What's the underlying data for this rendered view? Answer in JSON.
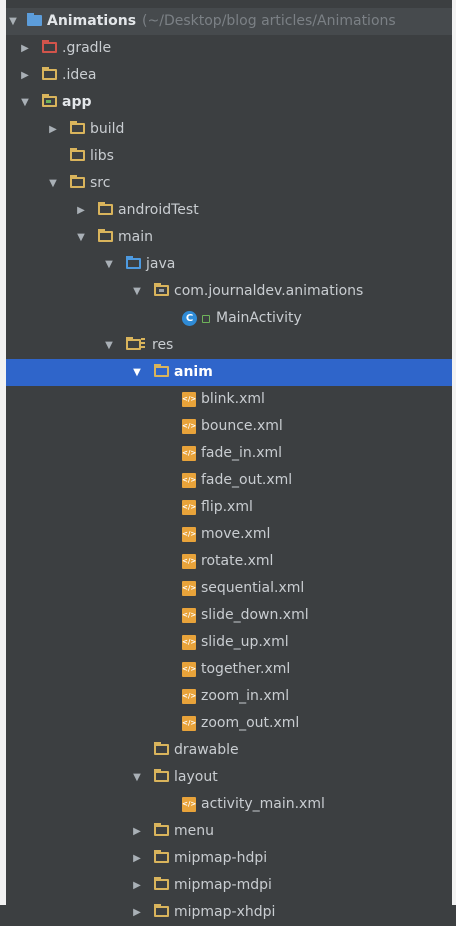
{
  "root": {
    "label": "Animations",
    "path": "(~/Desktop/blog articles/Animations"
  },
  "tree": [
    {
      "label": ".gradle",
      "depth": 1,
      "arrow": "right",
      "icon": "folder-red-icon",
      "kind": "folder red"
    },
    {
      "label": ".idea",
      "depth": 1,
      "arrow": "right",
      "icon": "folder-icon",
      "kind": "folder"
    },
    {
      "label": "app",
      "depth": 1,
      "arrow": "down",
      "icon": "app-module-folder-icon",
      "kind": "folder app",
      "bold": true
    },
    {
      "label": "build",
      "depth": 2,
      "arrow": "right",
      "icon": "folder-icon",
      "kind": "folder"
    },
    {
      "label": "libs",
      "depth": 2,
      "arrow": "",
      "icon": "folder-icon",
      "kind": "folder"
    },
    {
      "label": "src",
      "depth": 2,
      "arrow": "down",
      "icon": "folder-icon",
      "kind": "folder"
    },
    {
      "label": "androidTest",
      "depth": 3,
      "arrow": "right",
      "icon": "folder-icon",
      "kind": "folder"
    },
    {
      "label": "main",
      "depth": 3,
      "arrow": "down",
      "icon": "folder-icon",
      "kind": "folder"
    },
    {
      "label": "java",
      "depth": 4,
      "arrow": "down",
      "icon": "source-folder-icon",
      "kind": "folder blue"
    },
    {
      "label": "com.journaldev.animations",
      "depth": 5,
      "arrow": "down",
      "icon": "package-icon",
      "kind": "folder pkg"
    },
    {
      "label": "MainActivity",
      "depth": 6,
      "arrow": "",
      "icon": "class-icon",
      "kind": "class"
    },
    {
      "label": "res",
      "depth": 4,
      "arrow": "down",
      "icon": "resources-folder-icon",
      "kind": "folder res"
    },
    {
      "label": "anim",
      "depth": 5,
      "arrow": "down",
      "icon": "folder-icon",
      "kind": "folder",
      "selected": true
    },
    {
      "label": "blink.xml",
      "depth": 6,
      "arrow": "",
      "icon": "xml-file-icon",
      "kind": "xml"
    },
    {
      "label": "bounce.xml",
      "depth": 6,
      "arrow": "",
      "icon": "xml-file-icon",
      "kind": "xml"
    },
    {
      "label": "fade_in.xml",
      "depth": 6,
      "arrow": "",
      "icon": "xml-file-icon",
      "kind": "xml"
    },
    {
      "label": "fade_out.xml",
      "depth": 6,
      "arrow": "",
      "icon": "xml-file-icon",
      "kind": "xml"
    },
    {
      "label": "flip.xml",
      "depth": 6,
      "arrow": "",
      "icon": "xml-file-icon",
      "kind": "xml"
    },
    {
      "label": "move.xml",
      "depth": 6,
      "arrow": "",
      "icon": "xml-file-icon",
      "kind": "xml"
    },
    {
      "label": "rotate.xml",
      "depth": 6,
      "arrow": "",
      "icon": "xml-file-icon",
      "kind": "xml"
    },
    {
      "label": "sequential.xml",
      "depth": 6,
      "arrow": "",
      "icon": "xml-file-icon",
      "kind": "xml"
    },
    {
      "label": "slide_down.xml",
      "depth": 6,
      "arrow": "",
      "icon": "xml-file-icon",
      "kind": "xml"
    },
    {
      "label": "slide_up.xml",
      "depth": 6,
      "arrow": "",
      "icon": "xml-file-icon",
      "kind": "xml"
    },
    {
      "label": "together.xml",
      "depth": 6,
      "arrow": "",
      "icon": "xml-file-icon",
      "kind": "xml"
    },
    {
      "label": "zoom_in.xml",
      "depth": 6,
      "arrow": "",
      "icon": "xml-file-icon",
      "kind": "xml"
    },
    {
      "label": "zoom_out.xml",
      "depth": 6,
      "arrow": "",
      "icon": "xml-file-icon",
      "kind": "xml"
    },
    {
      "label": "drawable",
      "depth": 5,
      "arrow": "",
      "icon": "folder-icon",
      "kind": "folder"
    },
    {
      "label": "layout",
      "depth": 5,
      "arrow": "down",
      "icon": "folder-icon",
      "kind": "folder"
    },
    {
      "label": "activity_main.xml",
      "depth": 6,
      "arrow": "",
      "icon": "xml-file-icon",
      "kind": "xml"
    },
    {
      "label": "menu",
      "depth": 5,
      "arrow": "right",
      "icon": "folder-icon",
      "kind": "folder"
    },
    {
      "label": "mipmap-hdpi",
      "depth": 5,
      "arrow": "right",
      "icon": "folder-icon",
      "kind": "folder"
    },
    {
      "label": "mipmap-mdpi",
      "depth": 5,
      "arrow": "right",
      "icon": "folder-icon",
      "kind": "folder"
    },
    {
      "label": "mipmap-xhdpi",
      "depth": 5,
      "arrow": "right",
      "icon": "folder-icon",
      "kind": "folder"
    }
  ],
  "colors": {
    "background": "#3c3f41",
    "selection": "#2f65ca",
    "folder": "#d9b45c",
    "folder_excluded": "#d1544b",
    "source_folder": "#4d9ae0",
    "xml_file": "#e8a33a",
    "class": "#2f8bd6"
  }
}
